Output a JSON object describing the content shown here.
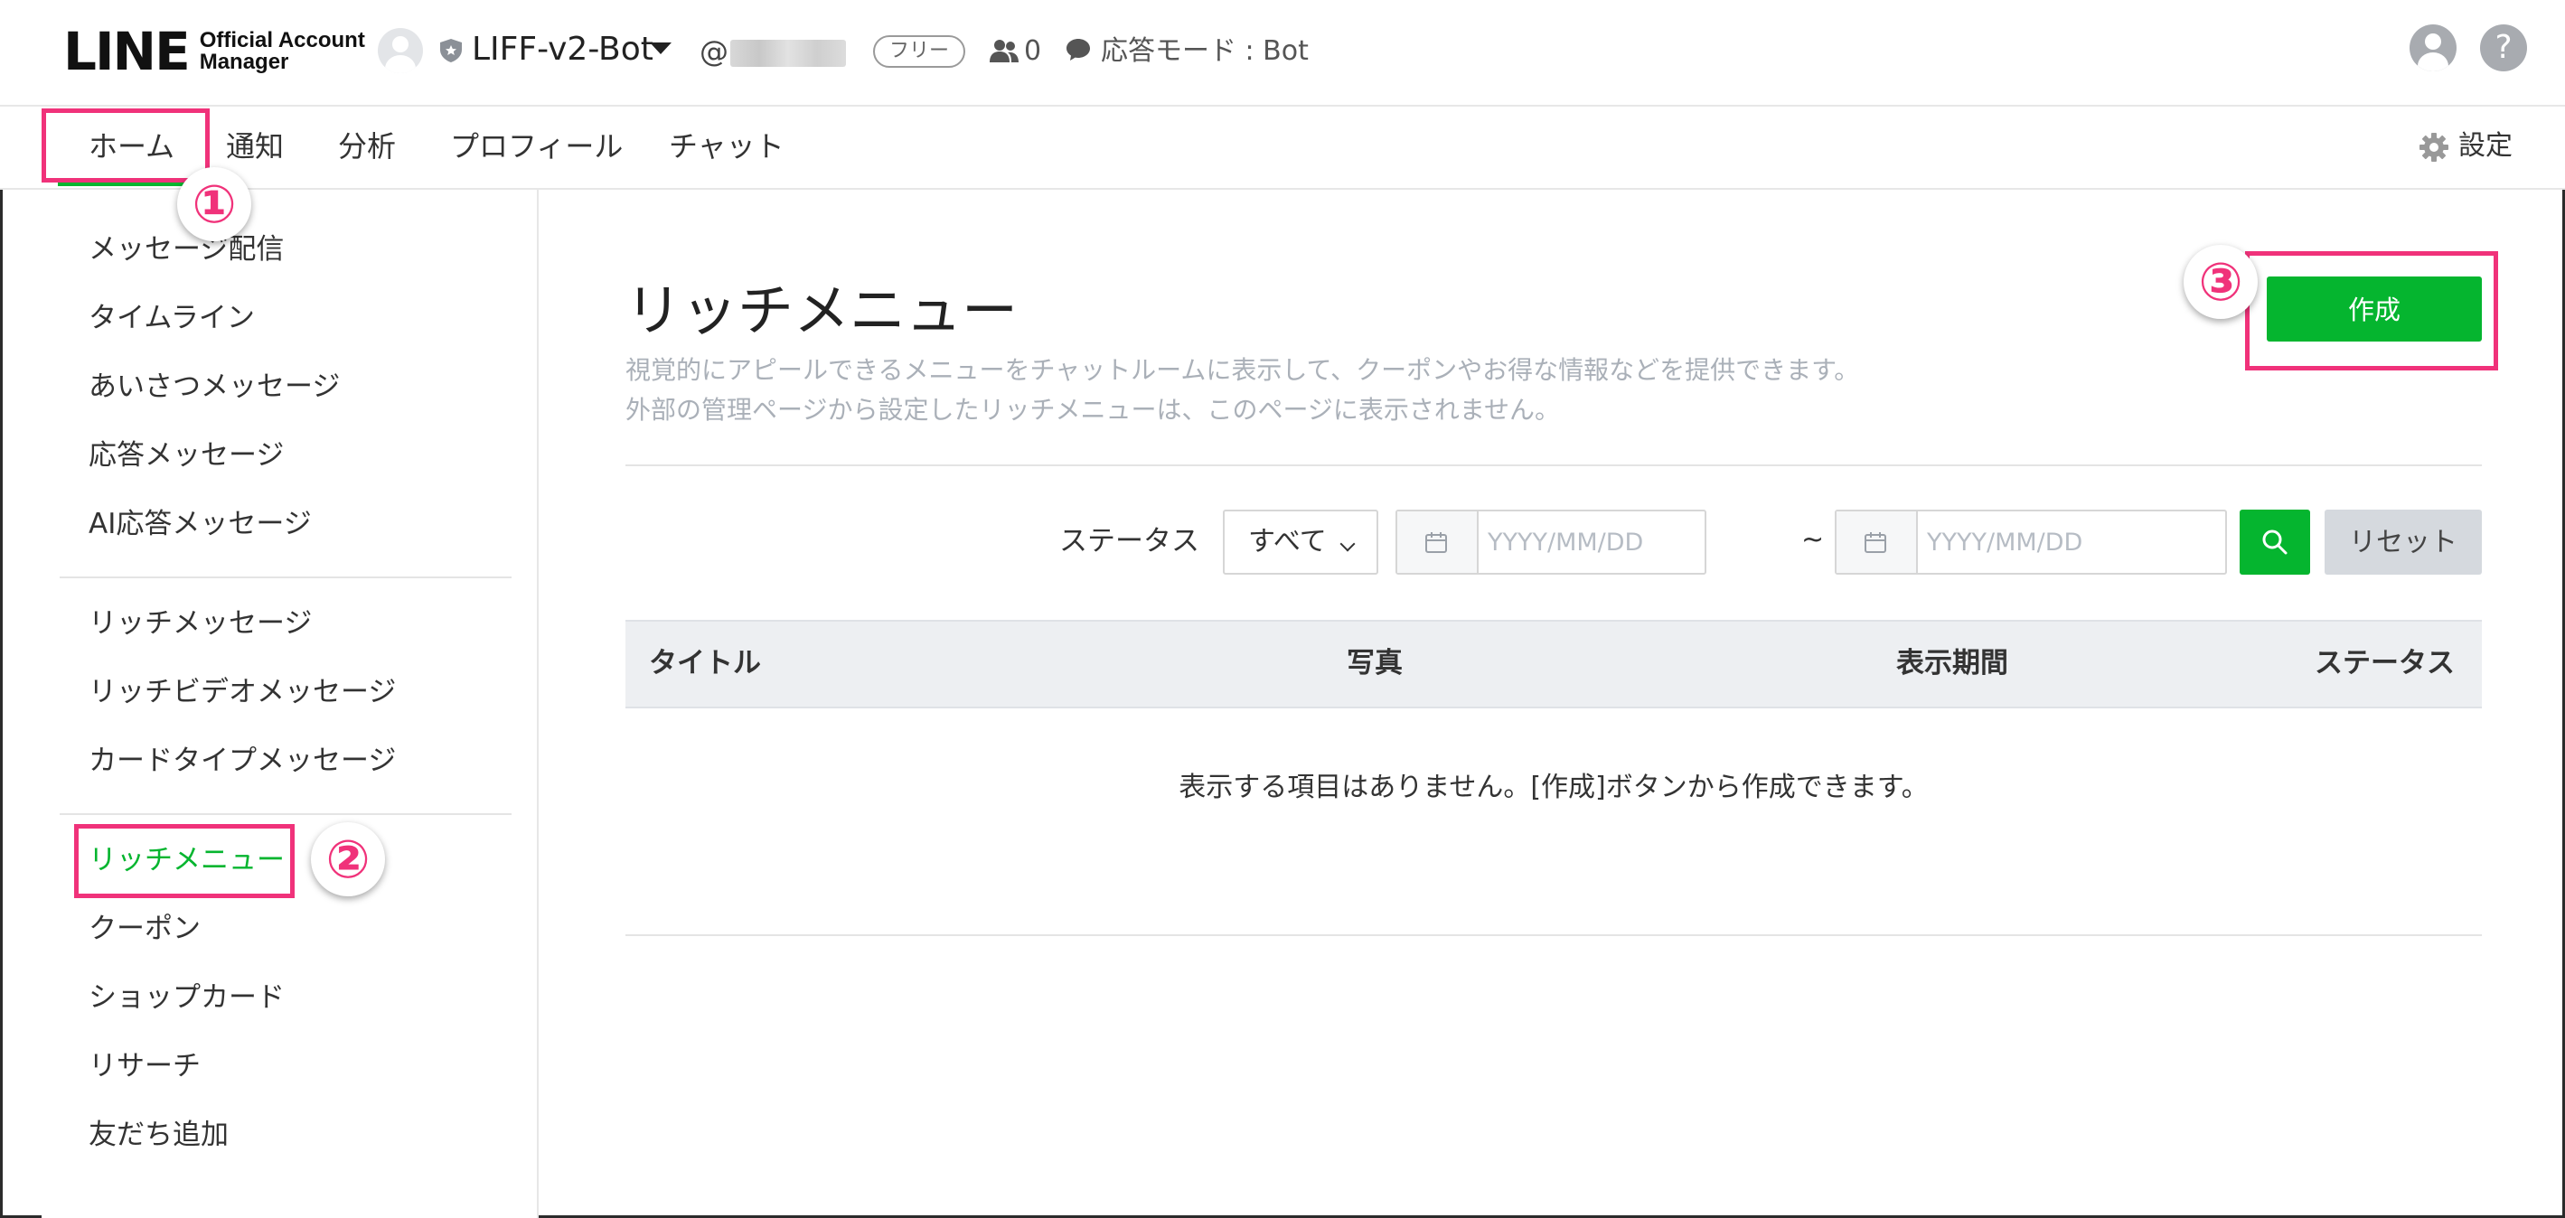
{
  "header": {
    "logo_main": "LINE",
    "logo_sub_line1": "Official Account",
    "logo_sub_line2": "Manager",
    "account_name": "LIFF-v2-Bot",
    "account_id_prefix": "@",
    "plan_badge": "フリー",
    "friends_count": "0",
    "response_mode": "応答モード : Bot"
  },
  "nav": {
    "tabs": [
      {
        "label": "ホーム",
        "active": true
      },
      {
        "label": "通知"
      },
      {
        "label": "分析"
      },
      {
        "label": "プロフィール"
      },
      {
        "label": "チャット"
      }
    ],
    "settings_label": "設定"
  },
  "sidebar": {
    "groups": [
      [
        "メッセージ配信",
        "タイムライン",
        "あいさつメッセージ",
        "応答メッセージ",
        "AI応答メッセージ"
      ],
      [
        "リッチメッセージ",
        "リッチビデオメッセージ",
        "カードタイプメッセージ"
      ],
      [
        "リッチメニュー",
        "クーポン",
        "ショップカード",
        "リサーチ",
        "友だち追加"
      ]
    ],
    "active_item": "リッチメニュー"
  },
  "main": {
    "title": "リッチメニュー",
    "description_line1": "視覚的にアピールできるメニューをチャットルームに表示して、クーポンやお得な情報などを提供できます。",
    "description_line2": "外部の管理ページから設定したリッチメニューは、このページに表示されません。",
    "create_button": "作成",
    "filter": {
      "status_label": "ステータス",
      "status_value": "すべて",
      "date_from_placeholder": "YYYY/MM/DD",
      "date_to_placeholder": "YYYY/MM/DD",
      "range_separator": "~",
      "reset_button": "リセット"
    },
    "table": {
      "columns": [
        "タイトル",
        "写真",
        "表示期間",
        "ステータス"
      ],
      "empty_message": "表示する項目はありません。[作成]ボタンから作成できます。"
    }
  },
  "annotations": {
    "markers": [
      "①",
      "②",
      "③"
    ],
    "highlight_color": "#f0327a"
  },
  "colors": {
    "accent_green": "#05b52f",
    "highlight_pink": "#f0327a"
  }
}
